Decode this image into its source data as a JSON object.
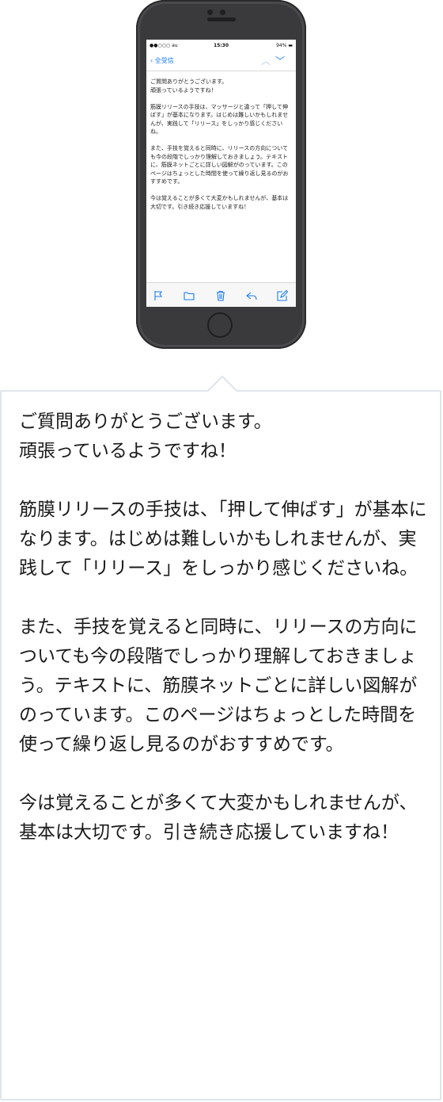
{
  "phone": {
    "status": {
      "carrier": "●●○○○ au",
      "time": "15:30",
      "battery": "94%"
    },
    "nav": {
      "back_label": "全受信"
    },
    "mail_body": "ご質問ありがとうございます。\n頑張っているようですね！\n\n筋膜リリースの手技は、マッサージと違って「押して伸ばす」が基本になります。はじめは難しいかもしれませんが、実践して「リリース」をしっかり感じくださいね。\n\nまた、手技を覚えると同時に、リリースの方向についても今の段階でしっかり理解しておきましょう。テキストに、筋膜ネットごとに詳しい図解がのっています。このページはちょっとした時間を使って繰り返し見るのがおすすめです。\n\n今は覚えることが多くて大変かもしれませんが、基本は大切です。引き続き応援していますね！",
    "toolbar_icons": [
      "flag-icon",
      "folder-icon",
      "trash-icon",
      "reply-icon",
      "compose-icon"
    ]
  },
  "bubble": {
    "text": "ご質問ありがとうございます。\n頑張っているようですね！\n\n筋膜リリースの手技は、「押して伸ばす」が基本になります。はじめは難しいかもしれませんが、実践して「リリース」をしっかり感じくださいね。\n\nまた、手技を覚えると同時に、リリースの方向についても今の段階でしっかり理解しておきましょう。テキストに、筋膜ネットごとに詳しい図解がのっています。このページはちょっとした時間を使って繰り返し見るのがおすすめです。\n\n今は覚えることが多くて大変かもしれませんが、基本は大切です。引き続き応援していますね！"
  },
  "colors": {
    "accent": "#1a7cf5",
    "phone_body": "#3a3a3c",
    "bubble_border": "#dde5ea"
  }
}
